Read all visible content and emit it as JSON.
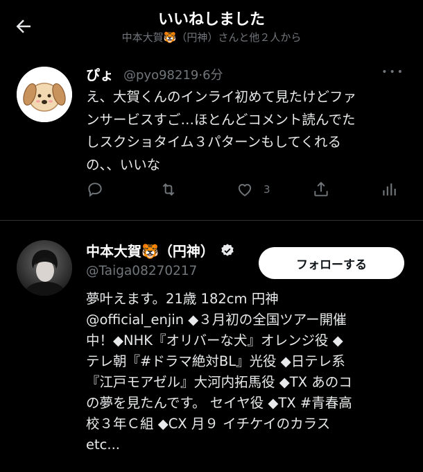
{
  "header": {
    "title": "いいねしました",
    "subtitle": "中本大賀🐯（円神）さんと他２人から"
  },
  "tweet": {
    "name": "ぴょ",
    "handle_time": "@pyo98219·6分",
    "body_lines": [
      "え、大賀くんのインライ初めて見たけどファ",
      "ンサービスすご…ほとんどコメント読んでた",
      "しスクショタイム３パターンもしてくれる",
      "の、、いいな"
    ],
    "like_count": "3"
  },
  "profile": {
    "name": "中本大賀🐯（円神）",
    "handle": "@Taiga08270217",
    "follow_label": "フォローする",
    "bio_lines": [
      "夢叶えます。21歳 182cm 円神",
      "@official_enjin ◆３月初の全国ツアー開催",
      "中！◆NHK『オリバーな犬』オレンジ役 ◆",
      "テレ朝『#ドラマ絶対BL』光役 ◆日テレ系",
      "『江戸モアゼル』大河内拓馬役 ◆TX あのコ",
      "の夢を見たんです。 セイヤ役 ◆TX #青春高",
      "校３年Ｃ組 ◆CX 月９ イチケイのカラス",
      "etc..."
    ]
  },
  "colors": {
    "background": "#000000",
    "text": "#e7e9ea",
    "secondary": "#71767b",
    "divider": "#2f3336"
  }
}
